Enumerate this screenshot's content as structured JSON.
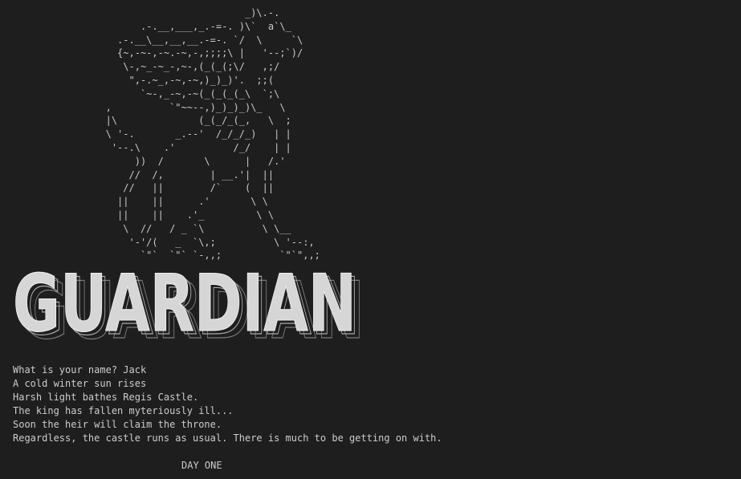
{
  "terminal": {
    "background_color": "#1e1e1e",
    "text_color": "#cccccc"
  },
  "ascii_art": {
    "subject": "knight-on-horse",
    "lines": [
      "                                        _)\\.-.",
      "                      .-.__,___,_.-=-. )\\`  a`\\_",
      "                  .-.__\\__,__,__.-=-. `/  \\     `\\",
      "                  {~,-~-,-~.-~,-,;;;;\\ |   '--;`)/",
      "                   \\-,~_-~_-,~-,(_(_(;\\/   ,;/",
      "                    \",-.~_,-~,-~,)_)_)'.  ;;(",
      "                      `~-,_-~,-~(_(_(_(_\\  `;\\",
      "                ,          `\"~~--,)_)_)_)\\_   \\",
      "                |\\              (_(_/_(_,   \\  ;",
      "                \\ '-.       _.--'  /_/_/_)   | |",
      "                 '--.\\    .'          /_/    | |",
      "                     ))  /       \\      |   /.'",
      "                    //  /,        | __.'|  ||",
      "                   //   ||        /`    (  ||",
      "                  ||    ||      .'       \\ \\",
      "                  ||    ||    .'_         \\ \\",
      "                   \\  //   / _ `\\          \\ \\__",
      "                    '-'/(   _  `\\,;          \\ '--:,",
      "                      `\"`  `\"` `-,,;          `\"`\",,;"
    ]
  },
  "title": {
    "text": "GUARDIAN"
  },
  "story": {
    "lines": [
      "What is your name? Jack",
      "A cold winter sun rises",
      "Harsh light bathes Regis Castle.",
      "The king has fallen myteriously ill...",
      "Soon the heir will claim the throne.",
      "Regardless, the castle runs as usual. There is much to be getting on with."
    ]
  },
  "day": {
    "label": "DAY ONE"
  }
}
